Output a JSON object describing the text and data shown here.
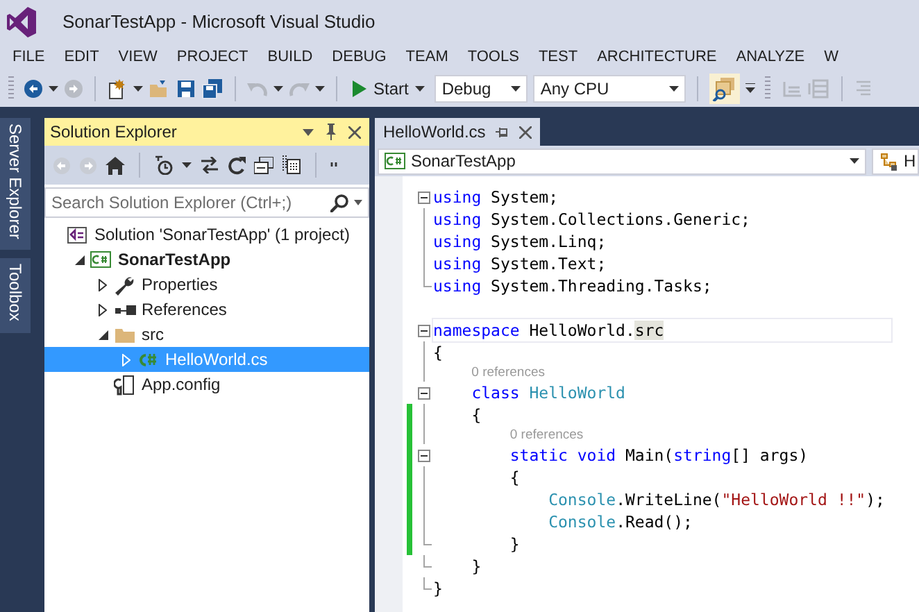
{
  "window": {
    "title": "SonarTestApp - Microsoft Visual Studio"
  },
  "menu": [
    "FILE",
    "EDIT",
    "VIEW",
    "PROJECT",
    "BUILD",
    "DEBUG",
    "TEAM",
    "TOOLS",
    "TEST",
    "ARCHITECTURE",
    "ANALYZE",
    "W"
  ],
  "toolbar": {
    "start": "Start",
    "configuration": "Debug",
    "platform": "Any CPU"
  },
  "side_tabs": [
    "Server Explorer",
    "Toolbox"
  ],
  "solution_explorer": {
    "title": "Solution Explorer",
    "search": {
      "placeholder": "Search Solution Explorer (Ctrl+;)"
    },
    "tree": [
      {
        "label": "Solution 'SonarTestApp' (1 project)",
        "kind": "solution",
        "selected": false,
        "children": [
          {
            "label": "SonarTestApp",
            "kind": "project",
            "selected": false,
            "expanded": true,
            "children": [
              {
                "label": "Properties",
                "kind": "properties",
                "selected": false,
                "expanded": false
              },
              {
                "label": "References",
                "kind": "references",
                "selected": false,
                "expanded": false
              },
              {
                "label": "src",
                "kind": "folder",
                "selected": false,
                "expanded": true,
                "children": [
                  {
                    "label": "HelloWorld.cs",
                    "kind": "csfile",
                    "selected": true,
                    "expanded": false
                  }
                ]
              },
              {
                "label": "App.config",
                "kind": "config",
                "selected": false
              }
            ]
          }
        ]
      }
    ]
  },
  "editor": {
    "tabs": [
      {
        "label": "HelloWorld.cs",
        "selected": true
      }
    ],
    "nav": {
      "project": "SonarTestApp",
      "member": "H"
    },
    "lines": [
      {
        "kind": "code",
        "fold": {
          "kind": "open"
        },
        "changed": false,
        "tokens": [
          {
            "kind": "keyword",
            "text": "using"
          },
          {
            "kind": "plain",
            "text": " System;"
          }
        ]
      },
      {
        "kind": "code",
        "fold": {
          "kind": "line"
        },
        "changed": false,
        "tokens": [
          {
            "kind": "keyword",
            "text": "using"
          },
          {
            "kind": "plain",
            "text": " System.Collections.Generic;"
          }
        ]
      },
      {
        "kind": "code",
        "fold": {
          "kind": "line"
        },
        "changed": false,
        "tokens": [
          {
            "kind": "keyword",
            "text": "using"
          },
          {
            "kind": "plain",
            "text": " System.Linq;"
          }
        ]
      },
      {
        "kind": "code",
        "fold": {
          "kind": "line"
        },
        "changed": false,
        "tokens": [
          {
            "kind": "keyword",
            "text": "using"
          },
          {
            "kind": "plain",
            "text": " System.Text;"
          }
        ]
      },
      {
        "kind": "code",
        "fold": {
          "kind": "end"
        },
        "changed": false,
        "tokens": [
          {
            "kind": "keyword",
            "text": "using"
          },
          {
            "kind": "plain",
            "text": " System.Threading.Tasks;"
          }
        ]
      },
      {
        "kind": "blank"
      },
      {
        "kind": "code",
        "fold": {
          "kind": "open"
        },
        "changed": false,
        "current": true,
        "tokens": [
          {
            "kind": "keyword",
            "text": "namespace"
          },
          {
            "kind": "plain",
            "text": " HelloWorld."
          },
          {
            "kind": "plain",
            "text": "src",
            "highlighted": true
          }
        ]
      },
      {
        "kind": "code",
        "fold": {
          "kind": "line"
        },
        "changed": false,
        "tokens": [
          {
            "kind": "plain",
            "text": "{"
          }
        ]
      },
      {
        "kind": "lens",
        "fold": {
          "kind": "line"
        },
        "changed": false,
        "text": "0 references"
      },
      {
        "kind": "code",
        "fold": {
          "kind": "open"
        },
        "changed": false,
        "tokens": [
          {
            "kind": "keyword",
            "text": "    class"
          },
          {
            "kind": "type",
            "text": " HelloWorld"
          }
        ]
      },
      {
        "kind": "code",
        "fold": {
          "kind": "line"
        },
        "changed": true,
        "tokens": [
          {
            "kind": "plain",
            "text": "    {"
          }
        ]
      },
      {
        "kind": "lens",
        "fold": {
          "kind": "line"
        },
        "changed": true,
        "text": "0 references"
      },
      {
        "kind": "code",
        "fold": {
          "kind": "open"
        },
        "changed": true,
        "tokens": [
          {
            "kind": "keyword",
            "text": "        static void"
          },
          {
            "kind": "plain",
            "text": " Main("
          },
          {
            "kind": "keyword",
            "text": "string"
          },
          {
            "kind": "plain",
            "text": "[] args)"
          }
        ]
      },
      {
        "kind": "code",
        "fold": {
          "kind": "line"
        },
        "changed": true,
        "tokens": [
          {
            "kind": "plain",
            "text": "        {"
          }
        ]
      },
      {
        "kind": "code",
        "fold": {
          "kind": "line"
        },
        "changed": true,
        "tokens": [
          {
            "kind": "type",
            "text": "            Console"
          },
          {
            "kind": "plain",
            "text": ".WriteLine("
          },
          {
            "kind": "string",
            "text": "\"HelloWorld !!\""
          },
          {
            "kind": "plain",
            "text": ");"
          }
        ]
      },
      {
        "kind": "code",
        "fold": {
          "kind": "line"
        },
        "changed": true,
        "tokens": [
          {
            "kind": "type",
            "text": "            Console"
          },
          {
            "kind": "plain",
            "text": ".Read();"
          }
        ]
      },
      {
        "kind": "code",
        "fold": {
          "kind": "end"
        },
        "changed": true,
        "tokens": [
          {
            "kind": "plain",
            "text": "        }"
          }
        ]
      },
      {
        "kind": "code",
        "fold": {
          "kind": "end"
        },
        "changed": false,
        "tokens": [
          {
            "kind": "plain",
            "text": "    }"
          }
        ]
      },
      {
        "kind": "code",
        "fold": {
          "kind": "end"
        },
        "changed": false,
        "tokens": [
          {
            "kind": "plain",
            "text": "}"
          }
        ]
      }
    ]
  }
}
